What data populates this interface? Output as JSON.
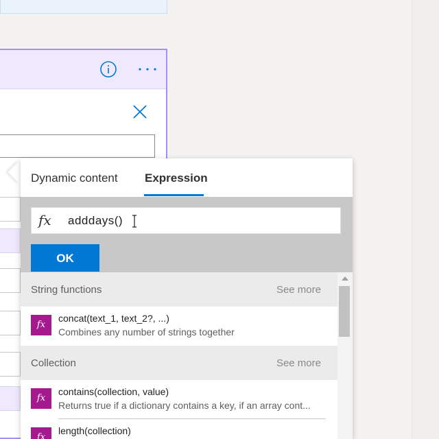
{
  "tabs": {
    "dynamic_content": "Dynamic content",
    "expression": "Expression"
  },
  "expression": {
    "fx_symbol": "fx",
    "value": "adddays()",
    "ok_label": "OK"
  },
  "sections": [
    {
      "title": "String functions",
      "see_more": "See more",
      "functions": [
        {
          "name": "concat(text_1, text_2?, ...)",
          "description": "Combines any number of strings together"
        }
      ]
    },
    {
      "title": "Collection",
      "see_more": "See more",
      "functions": [
        {
          "name": "contains(collection, value)",
          "description": "Returns true if a dictionary contains a key, if an array cont..."
        },
        {
          "name": "length(collection)",
          "description": ""
        }
      ]
    }
  ],
  "colors": {
    "accent": "#0078d4",
    "function_icon": "#a4198e",
    "card_border": "#a390f0"
  }
}
